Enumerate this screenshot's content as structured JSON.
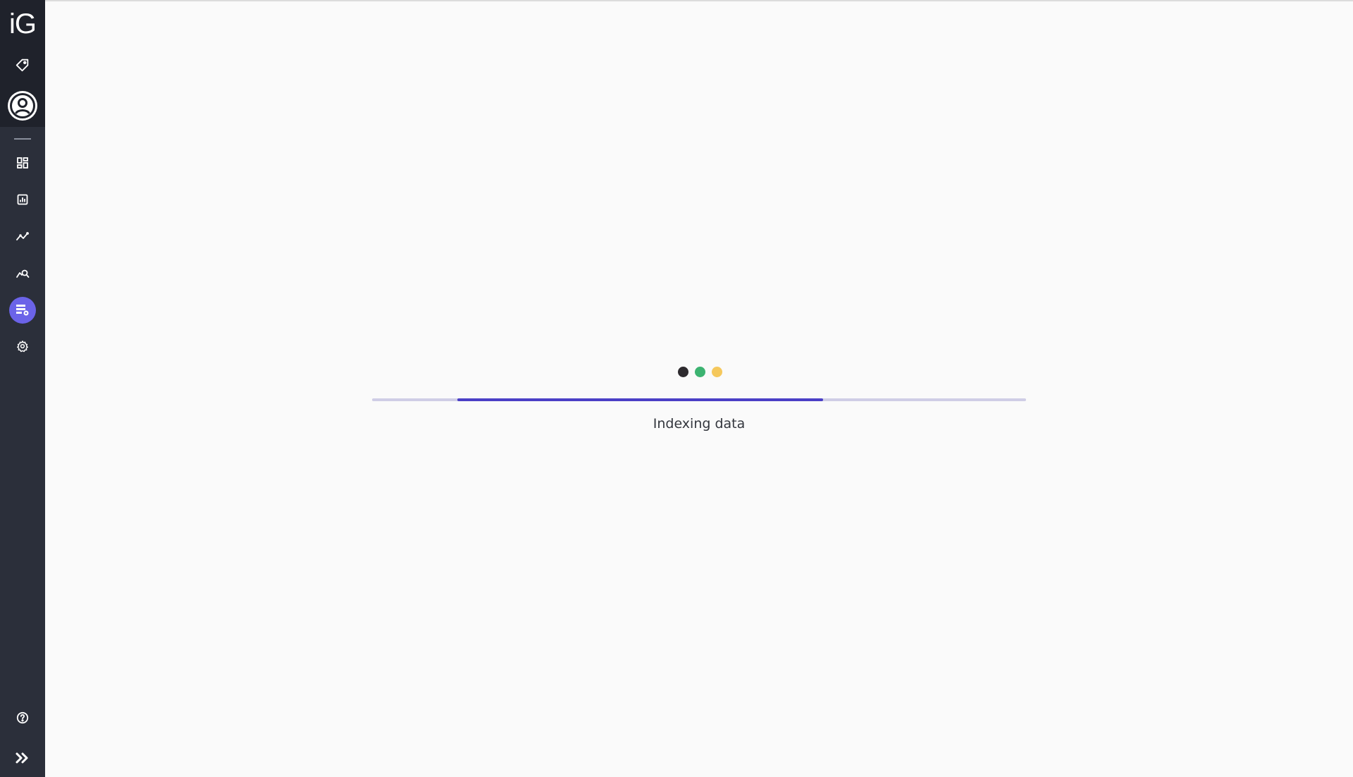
{
  "app": {
    "logo_text": "iG"
  },
  "sidebar": {
    "items": [
      {
        "icon": "tag-icon"
      },
      {
        "icon": "user-circle-icon"
      },
      {
        "icon": "dashboard-icon"
      },
      {
        "icon": "report-chart-icon"
      },
      {
        "icon": "trend-line-icon"
      },
      {
        "icon": "search-analytics-icon"
      },
      {
        "icon": "data-settings-icon",
        "active": true
      },
      {
        "icon": "gear-icon"
      },
      {
        "icon": "help-icon"
      },
      {
        "icon": "expand-chevrons-icon"
      }
    ]
  },
  "loader": {
    "dot_colors": [
      "#2d2a2e",
      "#3cb371",
      "#f5c85c"
    ],
    "progress": {
      "start_percent": 13,
      "end_percent": 69
    },
    "status_text": "Indexing data"
  },
  "colors": {
    "sidebar_bg": "#2b2f3a",
    "accent": "#6b63e8",
    "progress_fill": "#4a3fc6",
    "progress_track": "#cfcde6"
  }
}
